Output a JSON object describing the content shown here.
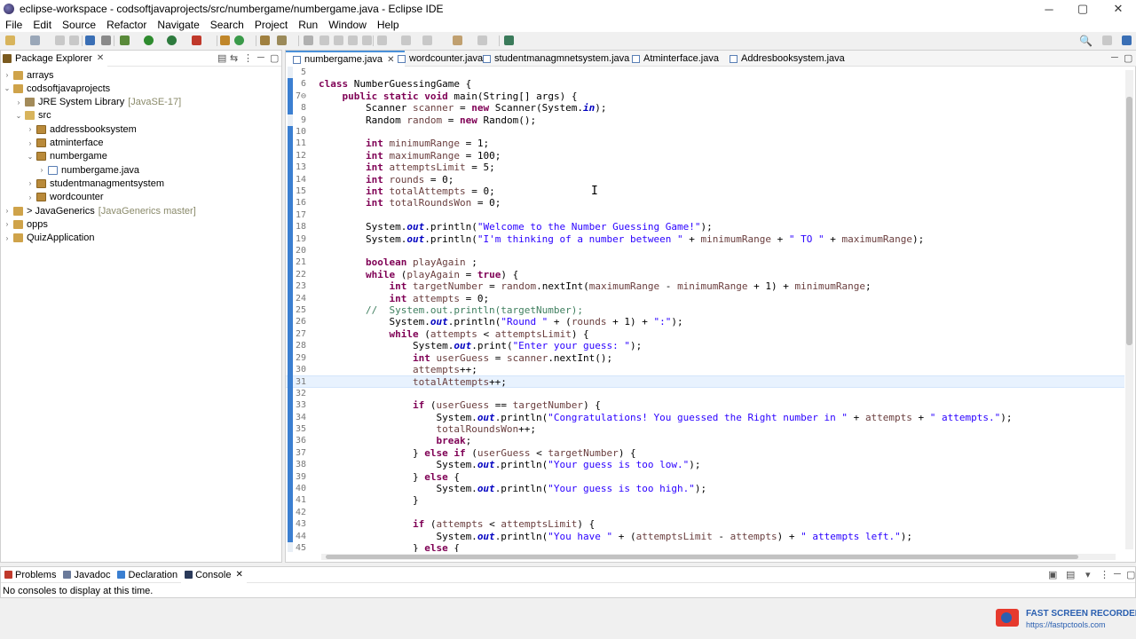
{
  "window": {
    "title": "eclipse-workspace - codsoftjavaprojects/src/numbergame/numbergame.java - Eclipse IDE",
    "minimize": "─",
    "maximize": "▢",
    "close": "✕"
  },
  "menu": [
    "File",
    "Edit",
    "Source",
    "Refactor",
    "Navigate",
    "Search",
    "Project",
    "Run",
    "Window",
    "Help"
  ],
  "package_explorer": {
    "title": "Package Explorer",
    "tree": [
      {
        "label": "arrays",
        "depth": 0,
        "twisty": "›",
        "icon": "project",
        "decoration": ""
      },
      {
        "label": "codsoftjavaprojects",
        "depth": 0,
        "twisty": "⌄",
        "icon": "project",
        "decoration": ""
      },
      {
        "label": "JRE System Library",
        "depth": 1,
        "twisty": "›",
        "icon": "lib",
        "decoration": "[JavaSE-17]"
      },
      {
        "label": "src",
        "depth": 1,
        "twisty": "⌄",
        "icon": "folder",
        "decoration": ""
      },
      {
        "label": "addressbooksystem",
        "depth": 2,
        "twisty": "›",
        "icon": "pkg",
        "decoration": ""
      },
      {
        "label": "atminterface",
        "depth": 2,
        "twisty": "›",
        "icon": "pkg",
        "decoration": ""
      },
      {
        "label": "numbergame",
        "depth": 2,
        "twisty": "⌄",
        "icon": "pkg",
        "decoration": ""
      },
      {
        "label": "numbergame.java",
        "depth": 3,
        "twisty": "›",
        "icon": "java",
        "decoration": ""
      },
      {
        "label": "studentmanagmentsystem",
        "depth": 2,
        "twisty": "›",
        "icon": "pkg",
        "decoration": ""
      },
      {
        "label": "wordcounter",
        "depth": 2,
        "twisty": "›",
        "icon": "pkg",
        "decoration": ""
      },
      {
        "label": "> JavaGenerics",
        "depth": 0,
        "twisty": "›",
        "icon": "project",
        "decoration": "[JavaGenerics master]"
      },
      {
        "label": "opps",
        "depth": 0,
        "twisty": "›",
        "icon": "project",
        "decoration": ""
      },
      {
        "label": "QuizApplication",
        "depth": 0,
        "twisty": "›",
        "icon": "project",
        "decoration": ""
      }
    ]
  },
  "editor": {
    "tabs": [
      {
        "label": "numbergame.java",
        "active": true
      },
      {
        "label": "wordcounter.java",
        "active": false
      },
      {
        "label": "studentmanagmnetsystem.java",
        "active": false
      },
      {
        "label": "Atminterface.java",
        "active": false
      },
      {
        "label": "Addresbooksystem.java",
        "active": false
      }
    ],
    "current_line": 31,
    "lines": [
      {
        "n": "5",
        "src": ""
      },
      {
        "n": "6",
        "src": "class NumberGuessingGame {"
      },
      {
        "n": "7⊖",
        "src": "    public static void main(String[] args) {"
      },
      {
        "n": "8",
        "src": "        Scanner scanner = new Scanner(System.in);"
      },
      {
        "n": "9",
        "src": "        Random random = new Random();"
      },
      {
        "n": "10",
        "src": ""
      },
      {
        "n": "11",
        "src": "        int minimumRange = 1;"
      },
      {
        "n": "12",
        "src": "        int maximumRange = 100;"
      },
      {
        "n": "13",
        "src": "        int attemptsLimit = 5;"
      },
      {
        "n": "14",
        "src": "        int rounds = 0;"
      },
      {
        "n": "15",
        "src": "        int totalAttempts = 0;"
      },
      {
        "n": "16",
        "src": "        int totalRoundsWon = 0;"
      },
      {
        "n": "17",
        "src": ""
      },
      {
        "n": "18",
        "src": "        System.out.println(\"Welcome to the Number Guessing Game!\");"
      },
      {
        "n": "19",
        "src": "        System.out.println(\"I'm thinking of a number between \" + minimumRange + \" TO \" + maximumRange);"
      },
      {
        "n": "20",
        "src": ""
      },
      {
        "n": "21",
        "src": "        boolean playAgain ;"
      },
      {
        "n": "22",
        "src": "        while (playAgain = true) {"
      },
      {
        "n": "23",
        "src": "            int targetNumber = random.nextInt(maximumRange - minimumRange + 1) + minimumRange;"
      },
      {
        "n": "24",
        "src": "            int attempts = 0;"
      },
      {
        "n": "25",
        "src": "        //  System.out.println(targetNumber);"
      },
      {
        "n": "26",
        "src": "            System.out.println(\"Round \" + (rounds + 1) + \":\");"
      },
      {
        "n": "27",
        "src": "            while (attempts < attemptsLimit) {"
      },
      {
        "n": "28",
        "src": "                System.out.print(\"Enter your guess: \");"
      },
      {
        "n": "29",
        "src": "                int userGuess = scanner.nextInt();"
      },
      {
        "n": "30",
        "src": "                attempts++;"
      },
      {
        "n": "31",
        "src": "                totalAttempts++;"
      },
      {
        "n": "32",
        "src": ""
      },
      {
        "n": "33",
        "src": "                if (userGuess == targetNumber) {"
      },
      {
        "n": "34",
        "src": "                    System.out.println(\"Congratulations! You guessed the Right number in \" + attempts + \" attempts.\");"
      },
      {
        "n": "35",
        "src": "                    totalRoundsWon++;"
      },
      {
        "n": "36",
        "src": "                    break;"
      },
      {
        "n": "37",
        "src": "                } else if (userGuess < targetNumber) {"
      },
      {
        "n": "38",
        "src": "                    System.out.println(\"Your guess is too low.\");"
      },
      {
        "n": "39",
        "src": "                } else {"
      },
      {
        "n": "40",
        "src": "                    System.out.println(\"Your guess is too high.\");"
      },
      {
        "n": "41",
        "src": "                }"
      },
      {
        "n": "42",
        "src": ""
      },
      {
        "n": "43",
        "src": "                if (attempts < attemptsLimit) {"
      },
      {
        "n": "44",
        "src": "                    System.out.println(\"You have \" + (attemptsLimit - attempts) + \" attempts left.\");"
      },
      {
        "n": "45",
        "src": "                } else {"
      }
    ]
  },
  "bottom_panel": {
    "tabs": [
      {
        "label": "Problems",
        "active": false
      },
      {
        "label": "Javadoc",
        "active": false
      },
      {
        "label": "Declaration",
        "active": false
      },
      {
        "label": "Console",
        "active": true
      }
    ],
    "message": "No consoles to display at this time."
  },
  "watermark": {
    "title": "FAST SCREEN RECORDER",
    "url": "https://fastpctools.com"
  },
  "colors": {
    "keyword": "#7f0055",
    "string": "#2a00ff",
    "field": "#0000c0",
    "comment": "#3f7f5f",
    "current_line": "#e8f2fe",
    "active_tab_accent": "#4a90d9"
  }
}
